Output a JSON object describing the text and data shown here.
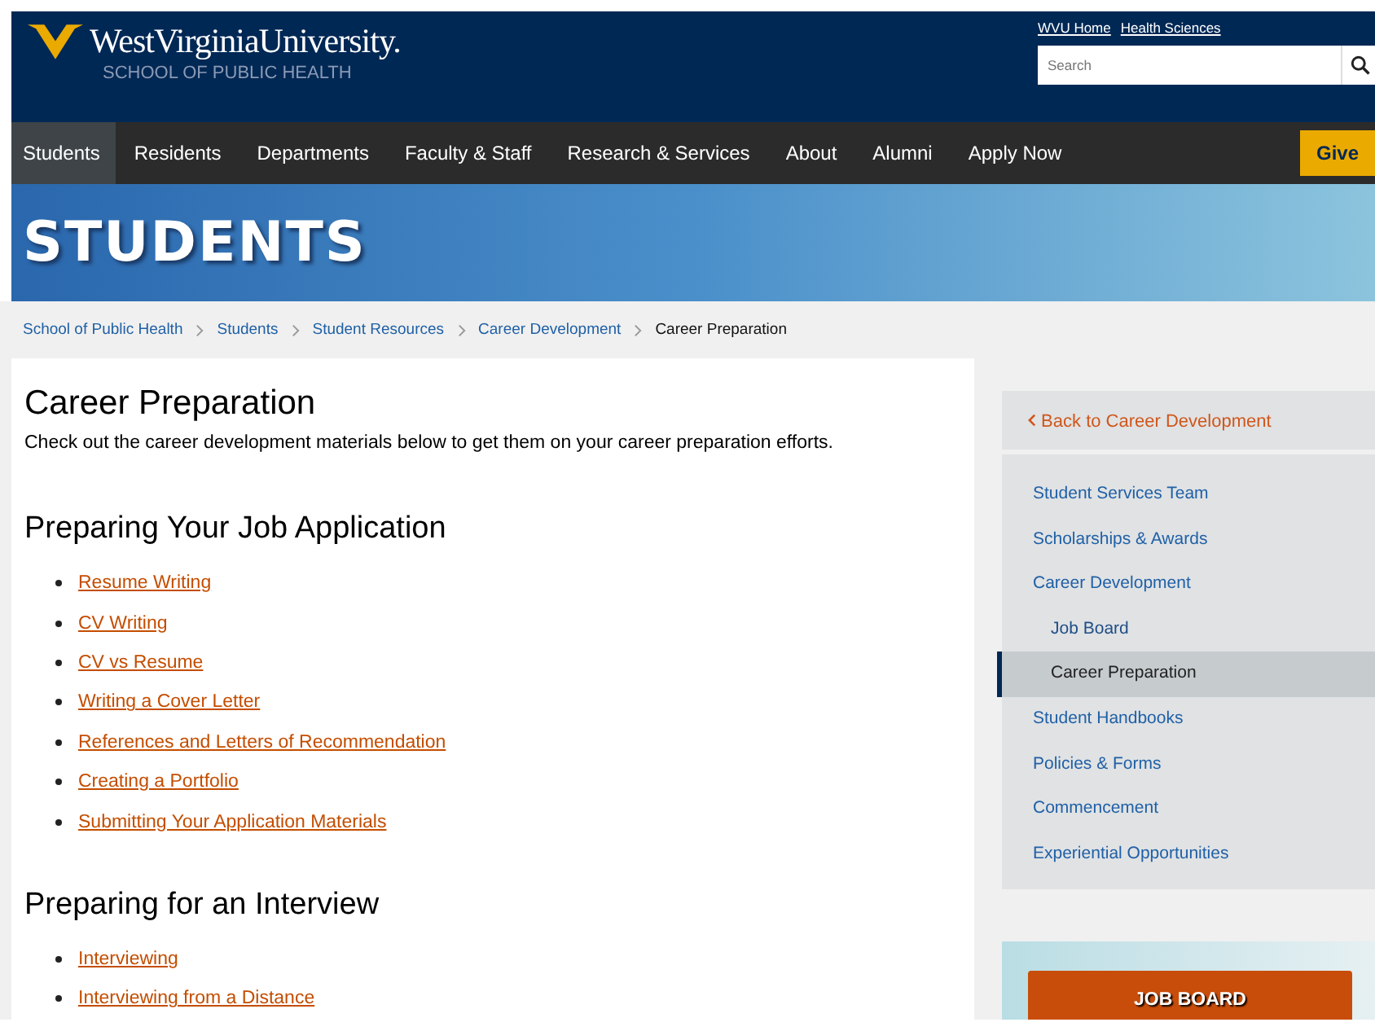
{
  "header": {
    "university": "WestVirginiaUniversity.",
    "school": "SCHOOL OF PUBLIC HEALTH",
    "top_links": [
      "WVU Home",
      "Health Sciences"
    ],
    "search": {
      "placeholder": "Search"
    }
  },
  "nav": {
    "items": [
      {
        "label": "Students",
        "selected": true
      },
      {
        "label": "Residents",
        "selected": false
      },
      {
        "label": "Departments",
        "selected": false
      },
      {
        "label": "Faculty & Staff",
        "selected": false
      },
      {
        "label": "Research & Services",
        "selected": false
      },
      {
        "label": "About",
        "selected": false
      },
      {
        "label": "Alumni",
        "selected": false
      },
      {
        "label": "Apply Now",
        "selected": false
      }
    ],
    "give": "Give"
  },
  "banner": {
    "title": "STUDENTS"
  },
  "breadcrumb": [
    "School of Public Health",
    "Students",
    "Student Resources",
    "Career Development",
    "Career Preparation"
  ],
  "main": {
    "title": "Career Preparation",
    "intro": "Check out the career development materials below to get them on your career preparation efforts.",
    "sections": [
      {
        "heading": "Preparing Your Job Application",
        "links": [
          "Resume Writing",
          "CV Writing",
          "CV vs Resume",
          "Writing a Cover Letter",
          "References and Letters of Recommendation",
          "Creating a Portfolio",
          "Submitting Your Application Materials"
        ]
      },
      {
        "heading": "Preparing for an Interview",
        "links": [
          "Interviewing",
          "Interviewing from a Distance"
        ]
      }
    ]
  },
  "sidebar": {
    "back": "Back to Career Development",
    "items": [
      {
        "label": "Student Services Team",
        "selected": false
      },
      {
        "label": "Scholarships & Awards",
        "selected": false
      },
      {
        "label": "Career Development",
        "selected": false,
        "children": [
          {
            "label": "Job Board",
            "selected": false
          },
          {
            "label": "Career Preparation",
            "selected": true
          }
        ]
      },
      {
        "label": "Student Handbooks",
        "selected": false
      },
      {
        "label": "Policies & Forms",
        "selected": false
      },
      {
        "label": "Commencement",
        "selected": false
      },
      {
        "label": "Experiential Opportunities",
        "selected": false
      }
    ],
    "button": "JOB BOARD"
  }
}
